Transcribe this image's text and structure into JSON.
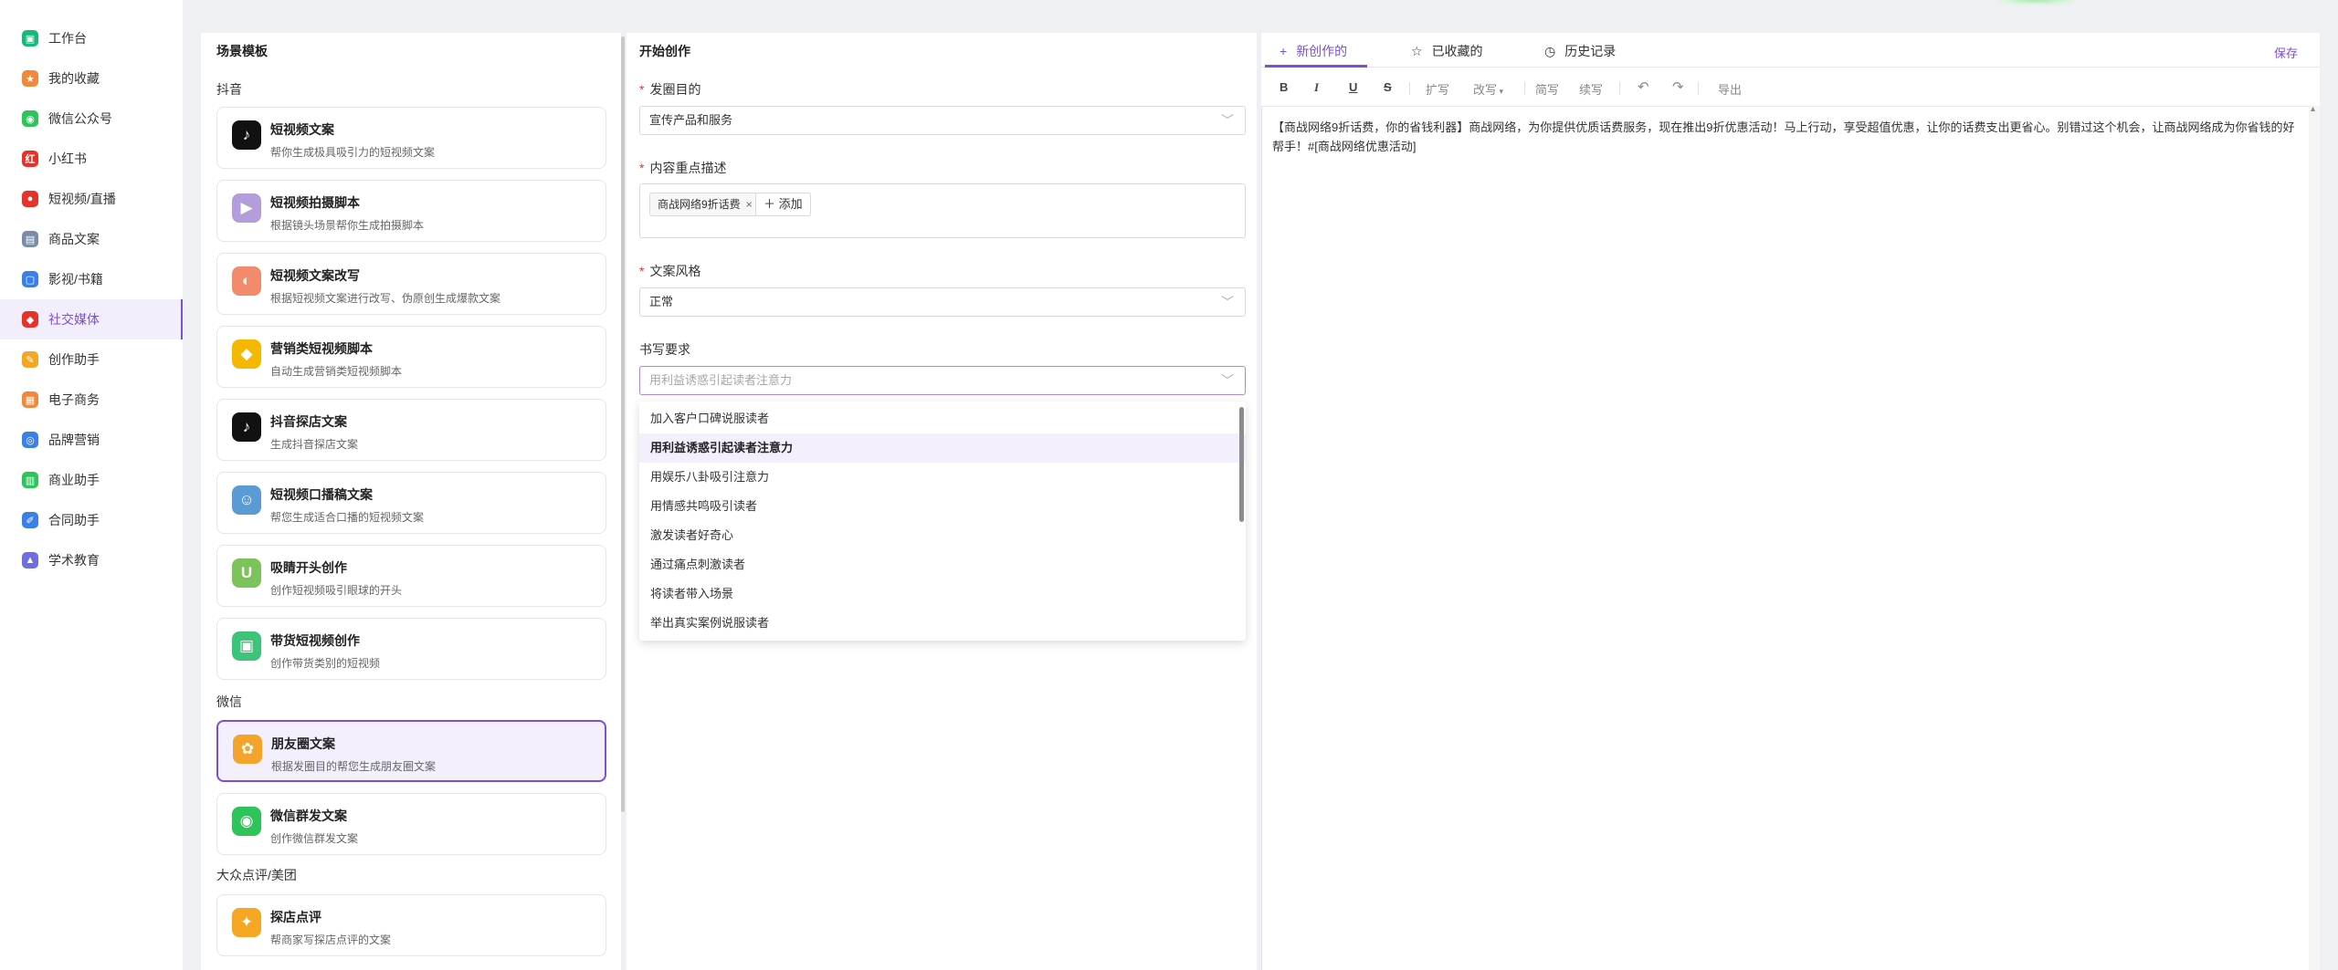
{
  "nav": {
    "items": [
      {
        "label": "工作台",
        "icon": "dashboard-icon",
        "color": "#17b978",
        "glyph": "▣"
      },
      {
        "label": "我的收藏",
        "icon": "star-icon",
        "color": "#f0883e",
        "glyph": "★"
      },
      {
        "label": "微信公众号",
        "icon": "wechat-icon",
        "color": "#2ec45a",
        "glyph": "◉"
      },
      {
        "label": "小红书",
        "icon": "xiaohongshu-icon",
        "color": "#e6332a",
        "glyph": "红"
      },
      {
        "label": "短视频/直播",
        "icon": "live-icon",
        "color": "#e6332a",
        "glyph": "●"
      },
      {
        "label": "商品文案",
        "icon": "store-icon",
        "color": "#7a8ca8",
        "glyph": "▤"
      },
      {
        "label": "影视/书籍",
        "icon": "lock-book-icon",
        "color": "#3b7fe8",
        "glyph": "▢"
      },
      {
        "label": "社交媒体",
        "icon": "cube-icon",
        "color": "#e6332a",
        "glyph": "◆"
      },
      {
        "label": "创作助手",
        "icon": "notebook-icon",
        "color": "#f5a623",
        "glyph": "✎"
      },
      {
        "label": "电子商务",
        "icon": "gift-icon",
        "color": "#f0883e",
        "glyph": "▦"
      },
      {
        "label": "品牌营销",
        "icon": "people-icon",
        "color": "#3b7fe8",
        "glyph": "◎"
      },
      {
        "label": "商业助手",
        "icon": "bar-chart-icon",
        "color": "#2ec45a",
        "glyph": "▥"
      },
      {
        "label": "合同助手",
        "icon": "contract-icon",
        "color": "#3b7fe8",
        "glyph": "✐"
      },
      {
        "label": "学术教育",
        "icon": "graduation-cap-icon",
        "color": "#6d6fe0",
        "glyph": "▲"
      }
    ],
    "active_index": 7
  },
  "scene": {
    "title": "场景模板",
    "sections": [
      {
        "label": "抖音"
      },
      {
        "label": "微信"
      },
      {
        "label": "大众点评/美团"
      }
    ],
    "cards": [
      {
        "title": "短视频文案",
        "desc": "帮你生成极具吸引力的短视频文案",
        "icon": "tiktok-icon",
        "color": "#111111",
        "glyph": "♪"
      },
      {
        "title": "短视频拍摄脚本",
        "desc": "根据镜头场景帮你生成拍摄脚本",
        "icon": "video-camera-icon",
        "color": "#b39ddb",
        "glyph": "▶"
      },
      {
        "title": "短视频文案改写",
        "desc": "根据短视频文案进行改写、伪原创生成爆款文案",
        "icon": "fire-icon",
        "color": "#f28b6b",
        "glyph": "◐"
      },
      {
        "title": "营销类短视频脚本",
        "desc": "自动生成营销类短视频脚本",
        "icon": "diamond-icon",
        "color": "#f5b800",
        "glyph": "◆"
      },
      {
        "title": "抖音探店文案",
        "desc": "生成抖音探店文案",
        "icon": "tiktok-icon",
        "color": "#111111",
        "glyph": "♪"
      },
      {
        "title": "短视频口播稿文案",
        "desc": "帮您生成适合口播的短视频文案",
        "icon": "avatar-icon",
        "color": "#5b9bd5",
        "glyph": "☺"
      },
      {
        "title": "吸睛开头创作",
        "desc": "创作短视频吸引眼球的开头",
        "icon": "magnet-icon",
        "color": "#7cc35b",
        "glyph": "U"
      },
      {
        "title": "带货短视频创作",
        "desc": "创作带货类别的短视频",
        "icon": "shopping-bag-icon",
        "color": "#3ec47a",
        "glyph": "▣"
      },
      {
        "title": "朋友圈文案",
        "desc": "根据发圈目的帮您生成朋友圈文案",
        "icon": "moments-icon",
        "color": "#f4a32b",
        "glyph": "✿"
      },
      {
        "title": "微信群发文案",
        "desc": "创作微信群发文案",
        "icon": "wechat-icon",
        "color": "#2ec45a",
        "glyph": "◉"
      },
      {
        "title": "探店点评",
        "desc": "帮商家写探店点评的文案",
        "icon": "dianping-icon",
        "color": "#f5a623",
        "glyph": "✦"
      }
    ],
    "selected_index": 8
  },
  "form": {
    "title": "开始创作",
    "purpose": {
      "label": "发圈目的",
      "value": "宣传产品和服务"
    },
    "content": {
      "label": "内容重点描述",
      "tag": "商战网络9折话费",
      "add_label": "添加"
    },
    "style": {
      "label": "文案风格",
      "value": "正常"
    },
    "requirement": {
      "label": "书写要求",
      "placeholder": "用利益诱惑引起读者注意力"
    },
    "options": [
      "加入客户口碑说服读者",
      "用利益诱惑引起读者注意力",
      "用娱乐八卦吸引注意力",
      "用情感共鸣吸引读者",
      "激发读者好奇心",
      "通过痛点刺激读者",
      "将读者带入场景",
      "举出真实案例说服读者"
    ],
    "active_option": 1
  },
  "editor": {
    "tabs": [
      {
        "label": "新创作的",
        "icon": "plus-icon",
        "glyph": "+"
      },
      {
        "label": "已收藏的",
        "icon": "star-outline-icon",
        "glyph": "☆"
      },
      {
        "label": "历史记录",
        "icon": "clock-icon",
        "glyph": "◷"
      }
    ],
    "active_tab": 0,
    "save_label": "保存",
    "toolbar": {
      "bold": "B",
      "italic": "I",
      "underline": "U",
      "strike": "S",
      "expand": "扩写",
      "rewrite": "改写",
      "simplify": "简写",
      "continue": "续写",
      "undo": "↶",
      "redo": "↷",
      "export": "导出"
    },
    "content": "【商战网络9折话费，你的省钱利器】商战网络，为你提供优质话费服务，现在推出9折优惠活动！马上行动，享受超值优惠，让你的话费支出更省心。别错过这个机会，让商战网络成为你省钱的好帮手！#[商战网络优惠活动]"
  }
}
